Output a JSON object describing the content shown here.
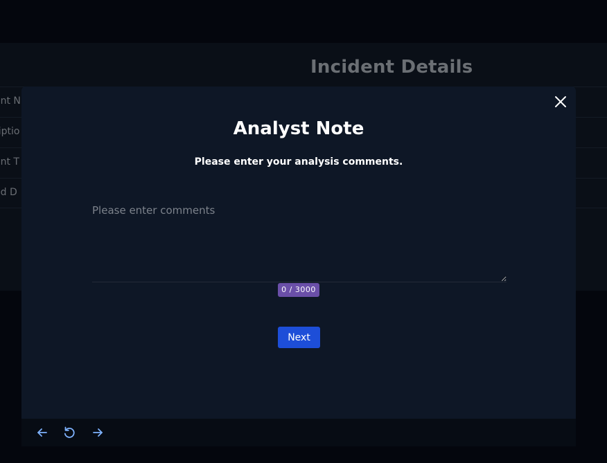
{
  "background": {
    "title": "Incident Details",
    "rows": [
      {
        "label": "ent N"
      },
      {
        "label": "riptio"
      },
      {
        "label": "ent T"
      },
      {
        "label": "ed D"
      }
    ]
  },
  "modal": {
    "title": "Analyst Note",
    "subtitle": "Please enter your analysis comments.",
    "comment_placeholder": "Please enter comments",
    "comment_value": "",
    "char_counter": "0 / 3000",
    "next_label": "Next"
  },
  "footer": {
    "icons": [
      "arrow-left-icon",
      "refresh-icon",
      "arrow-right-icon"
    ]
  },
  "colors": {
    "modal_bg": "#0e1726",
    "accent_button": "#1d4ed8",
    "counter_badge": "#6a4fa8",
    "footer_icon": "#7fb3ff"
  }
}
